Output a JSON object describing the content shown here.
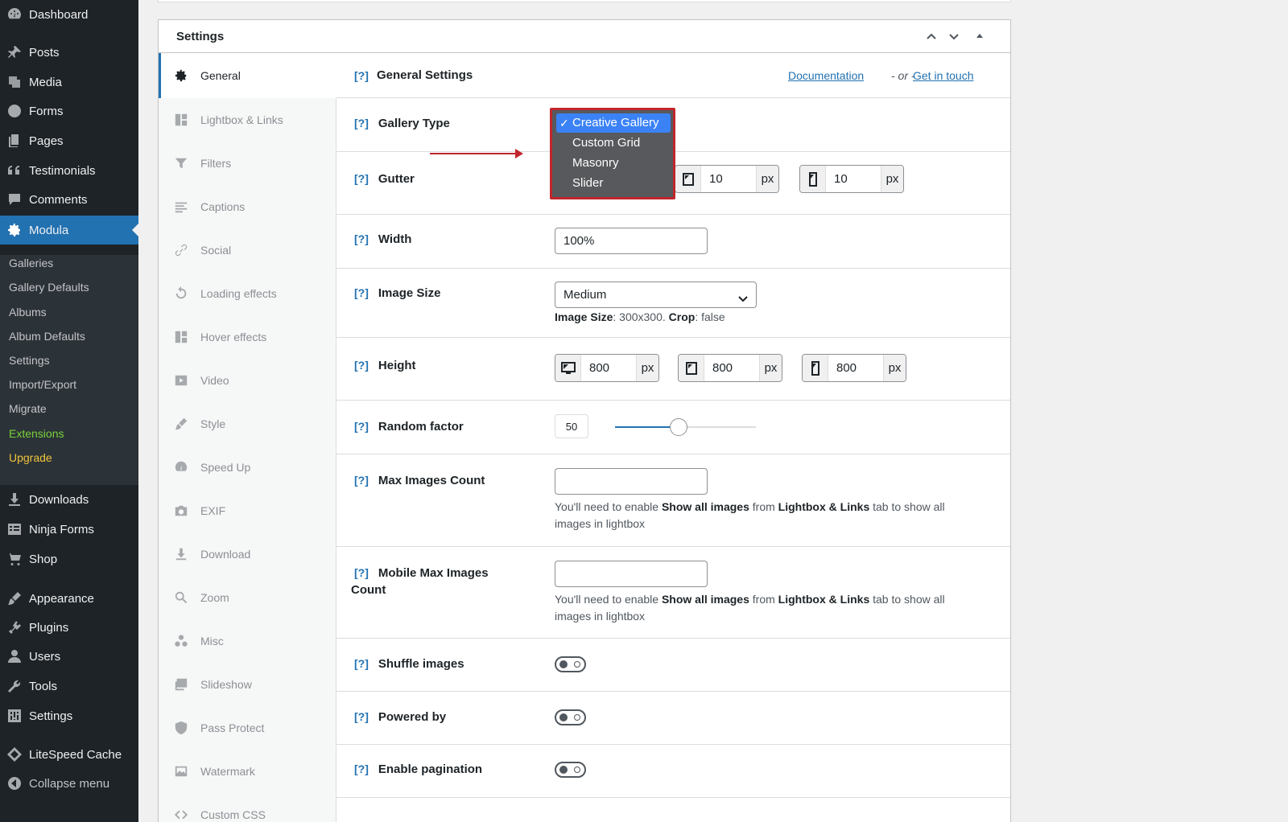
{
  "wp_menu": {
    "items": [
      {
        "label": "Dashboard",
        "icon": "dashboard-icon"
      },
      {
        "label": "Posts",
        "icon": "pin-icon"
      },
      {
        "label": "Media",
        "icon": "media-icon"
      },
      {
        "label": "Forms",
        "icon": "forms-icon"
      },
      {
        "label": "Pages",
        "icon": "pages-icon"
      },
      {
        "label": "Testimonials",
        "icon": "quote-icon"
      },
      {
        "label": "Comments",
        "icon": "comment-icon"
      },
      {
        "label": "Modula",
        "icon": "gear-icon"
      },
      {
        "label": "Downloads",
        "icon": "download-icon"
      },
      {
        "label": "Ninja Forms",
        "icon": "list-icon"
      },
      {
        "label": "Shop",
        "icon": "cart-icon"
      },
      {
        "label": "Appearance",
        "icon": "brush-icon"
      },
      {
        "label": "Plugins",
        "icon": "plug-icon"
      },
      {
        "label": "Users",
        "icon": "user-icon"
      },
      {
        "label": "Tools",
        "icon": "wrench-icon"
      },
      {
        "label": "Settings",
        "icon": "settings-icon"
      },
      {
        "label": "LiteSpeed Cache",
        "icon": "diamond-icon"
      },
      {
        "label": "Collapse menu",
        "icon": "collapse-icon"
      }
    ],
    "submenu": [
      "Galleries",
      "Gallery Defaults",
      "Albums",
      "Album Defaults",
      "Settings",
      "Import/Export",
      "Migrate",
      "Extensions",
      "Upgrade"
    ]
  },
  "box": {
    "title": "Settings"
  },
  "tabs": [
    "General",
    "Lightbox & Links",
    "Filters",
    "Captions",
    "Social",
    "Loading effects",
    "Hover effects",
    "Video",
    "Style",
    "Speed Up",
    "EXIF",
    "Download",
    "Zoom",
    "Misc",
    "Slideshow",
    "Pass Protect",
    "Watermark",
    "Custom CSS"
  ],
  "panel": {
    "help": "[?]",
    "title": "General Settings",
    "documentation": "Documentation",
    "or": "- or -",
    "contact": "Get in touch"
  },
  "fields": {
    "gallery_type": {
      "label": "Gallery Type",
      "options": [
        "Creative Gallery",
        "Custom Grid",
        "Masonry",
        "Slider"
      ],
      "selected": "Creative Gallery",
      "check": "✓"
    },
    "gutter": {
      "label": "Gutter",
      "tablet": "10",
      "mobile": "10",
      "unit": "px"
    },
    "width": {
      "label": "Width",
      "value": "100%"
    },
    "image_size": {
      "label": "Image Size",
      "value": "Medium",
      "info_label": "Image Size",
      "info_dims": ": 300x300. ",
      "crop_label": "Crop",
      "crop_value": ": false"
    },
    "height": {
      "label": "Height",
      "desktop": "800",
      "tablet": "800",
      "mobile": "800",
      "unit": "px"
    },
    "random_factor": {
      "label": "Random factor",
      "value": "50",
      "fraction": 0.45
    },
    "max_images": {
      "label": "Max Images Count",
      "value": ""
    },
    "mobile_max_images": {
      "label_line1": "Mobile Max Images",
      "label_line2": "Count",
      "value": ""
    },
    "lightbox_note": {
      "pre": "You'll need to enable ",
      "b1": "Show all images",
      "mid": " from ",
      "b2": "Lightbox & Links",
      "post": " tab to show all",
      "line2": "images in lightbox"
    },
    "shuffle": {
      "label": "Shuffle images",
      "on": false
    },
    "powered_by": {
      "label": "Powered by",
      "on": false
    },
    "pagination": {
      "label": "Enable pagination",
      "on": false
    }
  },
  "colors": {
    "accent": "#2271b1",
    "sidebar": "#1d2327",
    "highlight_border": "#c0262c",
    "dropdown_selected": "#3b82f6"
  }
}
